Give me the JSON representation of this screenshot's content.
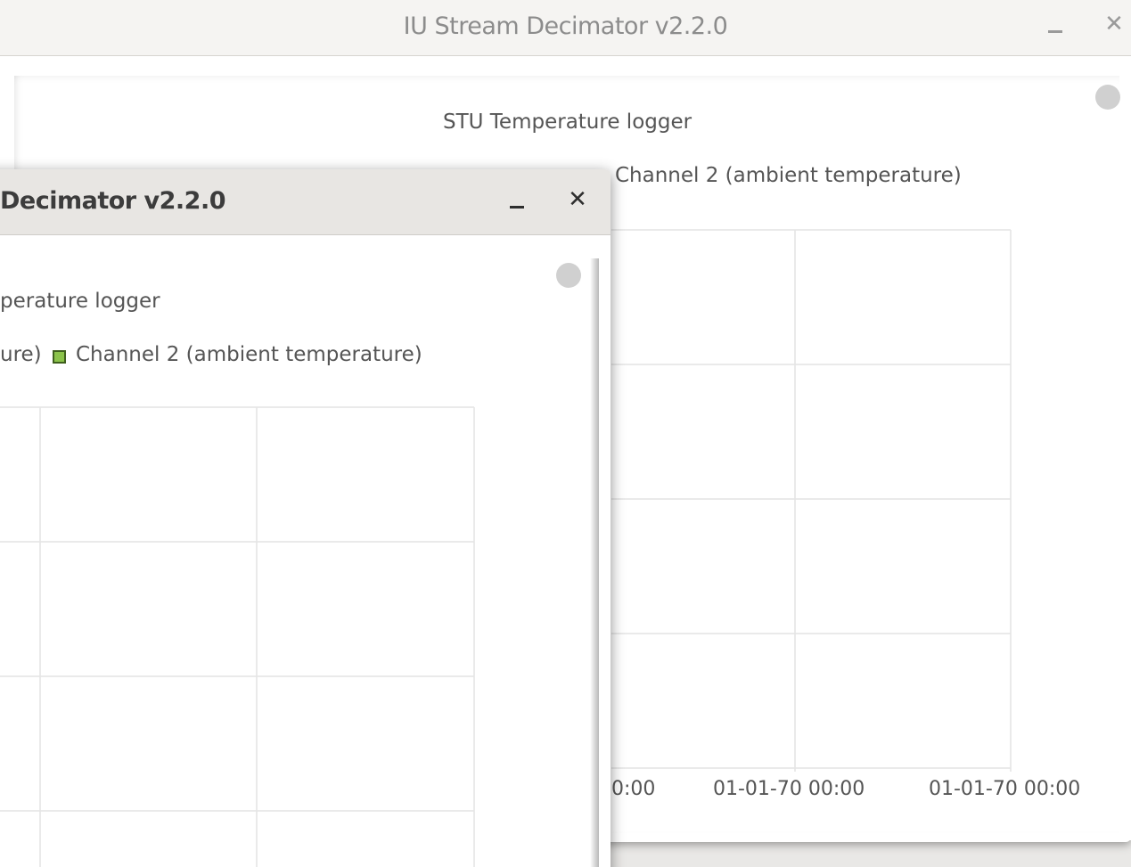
{
  "back_window": {
    "title": "IU Stream Decimator v2.2.0",
    "minimize_symbol": "–",
    "close_symbol": "✕",
    "chart": {
      "title": "STU Temperature logger",
      "legend_ch2": "Channel 2 (ambient temperature)",
      "x_tick_labels": [
        "0:00",
        "01-01-70 00:00",
        "01-01-70 00:00"
      ]
    }
  },
  "front_window": {
    "title": "Decimator v2.2.0",
    "minimize_symbol": "–",
    "close_symbol": "✕",
    "chart": {
      "title": "perature logger",
      "legend_ch1": "ure)",
      "legend_ch2": "Channel 2 (ambient temperature)",
      "legend_ch2_color": "#8bc34a"
    }
  },
  "colors": {
    "grid": "#e6e6e6",
    "status_dot": "#d0d0d0"
  }
}
